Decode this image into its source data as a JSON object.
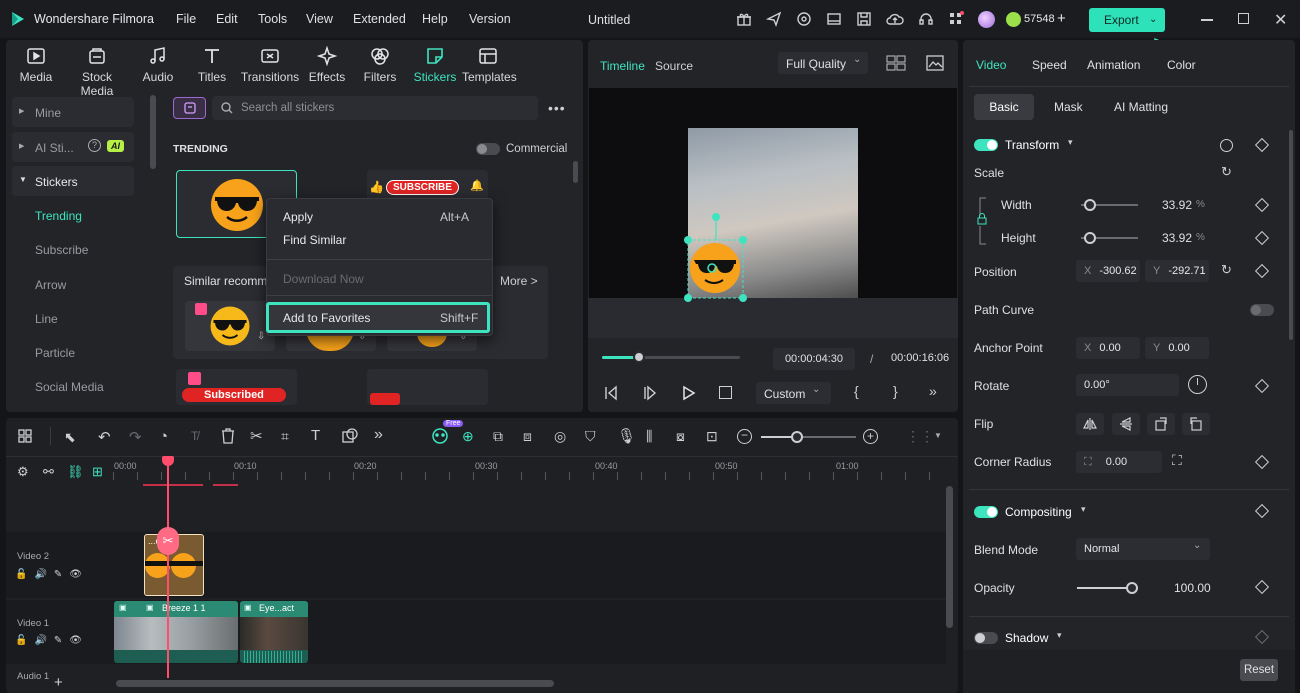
{
  "app": {
    "name": "Wondershare Filmora",
    "doc_title": "Untitled",
    "credits": "57548",
    "export_label": "Export"
  },
  "menu": [
    "File",
    "Edit",
    "Tools",
    "View",
    "Extended",
    "Help",
    "Version"
  ],
  "media_tabs": [
    "Media",
    "Stock Media",
    "Audio",
    "Titles",
    "Transitions",
    "Effects",
    "Filters",
    "Stickers",
    "Templates"
  ],
  "sidebar": {
    "mine": "Mine",
    "ai": "AI Sti...",
    "ai_badge": "AI",
    "stickers": "Stickers",
    "items": [
      "Trending",
      "Subscribe",
      "Arrow",
      "Line",
      "Particle",
      "Social Media"
    ]
  },
  "search": {
    "placeholder": "Search all stickers"
  },
  "stickers": {
    "section": "TRENDING",
    "commercial": "Commercial",
    "similar": "Similar recomme",
    "more": "More >",
    "subscribe": "SUBSCRIBE",
    "subscribed": "Subscribed"
  },
  "context_menu": {
    "apply": "Apply",
    "apply_key": "Alt+A",
    "find_similar": "Find Similar",
    "download": "Download Now",
    "favorites": "Add to Favorites",
    "favorites_key": "Shift+F"
  },
  "preview": {
    "tab_timeline": "Timeline",
    "tab_source": "Source",
    "quality": "Full Quality",
    "current_time": "00:00:04:30",
    "sep": "/",
    "total_time": "00:00:16:06",
    "zoom": "Custom",
    "progress": 0.27
  },
  "props": {
    "tabs": [
      "Video",
      "Speed",
      "Animation",
      "Color"
    ],
    "subtabs": [
      "Basic",
      "Mask",
      "AI Matting"
    ],
    "transform": "Transform",
    "scale": "Scale",
    "width_lbl": "Width",
    "width_val": "33.92",
    "height_lbl": "Height",
    "height_val": "33.92",
    "pct": "%",
    "position": "Position",
    "pos_x_lbl": "X",
    "pos_x": "-300.62",
    "pos_y_lbl": "Y",
    "pos_y": "-292.71",
    "path_curve": "Path Curve",
    "anchor": "Anchor Point",
    "anchor_x": "0.00",
    "anchor_y": "0.00",
    "rotate": "Rotate",
    "rotate_val": "0.00°",
    "flip": "Flip",
    "corner": "Corner Radius",
    "corner_val": "0.00",
    "compositing": "Compositing",
    "blend": "Blend Mode",
    "blend_val": "Normal",
    "opacity": "Opacity",
    "opacity_val": "100.00",
    "shadow": "Shadow",
    "reset": "Reset"
  },
  "timeline": {
    "ticks": [
      "00:00",
      "00:10",
      "00:20",
      "00:30",
      "00:40",
      "00:50",
      "01:00"
    ],
    "free_badge": "Free",
    "track_v2": "Video 2",
    "track_v1": "Video 1",
    "track_a1": "Audio 1",
    "clip_sticker": "...es",
    "clip_breeze": "Breeze 1 1",
    "clip_eye": "Eye...act"
  },
  "colors": {
    "accent": "#3ee4c0",
    "playhead": "#ff4d6b",
    "export": "#2de1b9"
  }
}
